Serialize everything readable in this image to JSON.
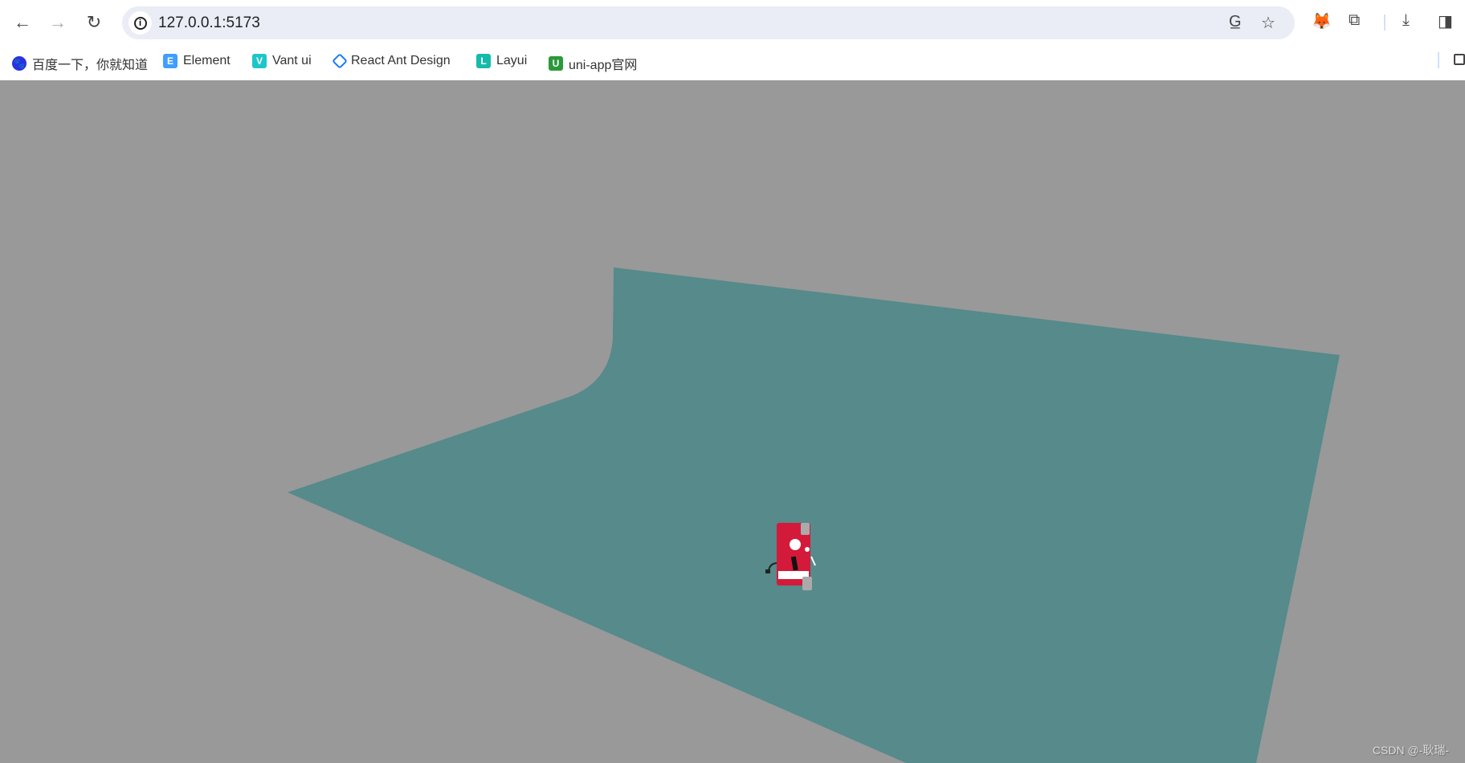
{
  "browser": {
    "url": "127.0.0.1:5173",
    "bookmarks": [
      {
        "label": "百度一下，你就知道",
        "icon": "baidu-icon",
        "color": "#2932e1"
      },
      {
        "label": "Element",
        "icon": "element-icon",
        "color": "#409eff"
      },
      {
        "label": "Vant ui",
        "icon": "vant-icon",
        "color": "#1fc6c8"
      },
      {
        "label": "React Ant Design",
        "icon": "ant-design-icon",
        "color": "#1677ff"
      },
      {
        "label": "Layui",
        "icon": "layui-icon",
        "color": "#16baaa"
      },
      {
        "label": "uni-app官网",
        "icon": "uniapp-icon",
        "color": "#2b9939"
      }
    ]
  },
  "scene": {
    "background": "#999999",
    "plane_color": "#568a8b",
    "model_color": "#d31a3a"
  },
  "watermark": "CSDN @-耿瑞-"
}
